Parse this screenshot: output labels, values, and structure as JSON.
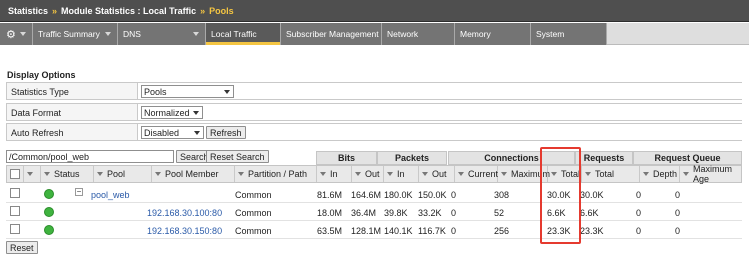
{
  "breadcrumb": {
    "part1": "Statistics",
    "sep1": "»",
    "part2": "Module Statistics : Local Traffic",
    "sep2": "»",
    "current": "Pools"
  },
  "tabs": [
    {
      "label": "Traffic Summary"
    },
    {
      "label": "DNS"
    },
    {
      "label": "Local Traffic"
    },
    {
      "label": "Subscriber Management"
    },
    {
      "label": "Network"
    },
    {
      "label": "Memory"
    },
    {
      "label": "System"
    }
  ],
  "display_options": {
    "title": "Display Options",
    "statistics_type": {
      "label": "Statistics Type",
      "value": "Pools"
    },
    "data_format": {
      "label": "Data Format",
      "value": "Normalized"
    },
    "auto_refresh": {
      "label": "Auto Refresh",
      "value": "Disabled",
      "refresh_button": "Refresh"
    }
  },
  "search": {
    "value": "/Common/pool_web",
    "search_button": "Search",
    "reset_search_button": "Reset Search"
  },
  "groups": {
    "bits": "Bits",
    "packets": "Packets",
    "connections": "Connections",
    "requests": "Requests",
    "request_queue": "Request Queue"
  },
  "columns": {
    "status": "Status",
    "pool": "Pool",
    "pool_member": "Pool Member",
    "partition": "Partition / Path",
    "bits_in": "In",
    "bits_out": "Out",
    "packets_in": "In",
    "packets_out": "Out",
    "current": "Current",
    "maximum": "Maximum",
    "total": "Total",
    "req_total": "Total",
    "depth": "Depth",
    "max_age": "Maximum Age"
  },
  "rows": [
    {
      "pool": "pool_web",
      "member": "",
      "partition": "Common",
      "bits_in": "81.6M",
      "bits_out": "164.6M",
      "pkts_in": "180.0K",
      "pkts_out": "150.0K",
      "current": "0",
      "maximum": "308",
      "total": "30.0K",
      "req_total": "30.0K",
      "depth": "0",
      "max_age": "0"
    },
    {
      "pool": "",
      "member": "192.168.30.100:80",
      "partition": "Common",
      "bits_in": "18.0M",
      "bits_out": "36.4M",
      "pkts_in": "39.8K",
      "pkts_out": "33.2K",
      "current": "0",
      "maximum": "52",
      "total": "6.6K",
      "req_total": "6.6K",
      "depth": "0",
      "max_age": "0"
    },
    {
      "pool": "",
      "member": "192.168.30.150:80",
      "partition": "Common",
      "bits_in": "63.5M",
      "bits_out": "128.1M",
      "pkts_in": "140.1K",
      "pkts_out": "116.7K",
      "current": "0",
      "maximum": "256",
      "total": "23.3K",
      "req_total": "23.3K",
      "depth": "0",
      "max_age": "0"
    }
  ],
  "reset_button": "Reset",
  "colors": {
    "accent": "#f4c542",
    "highlight": "#e53a2f",
    "status_green": "#3fb33f",
    "link": "#2a5aa8"
  }
}
